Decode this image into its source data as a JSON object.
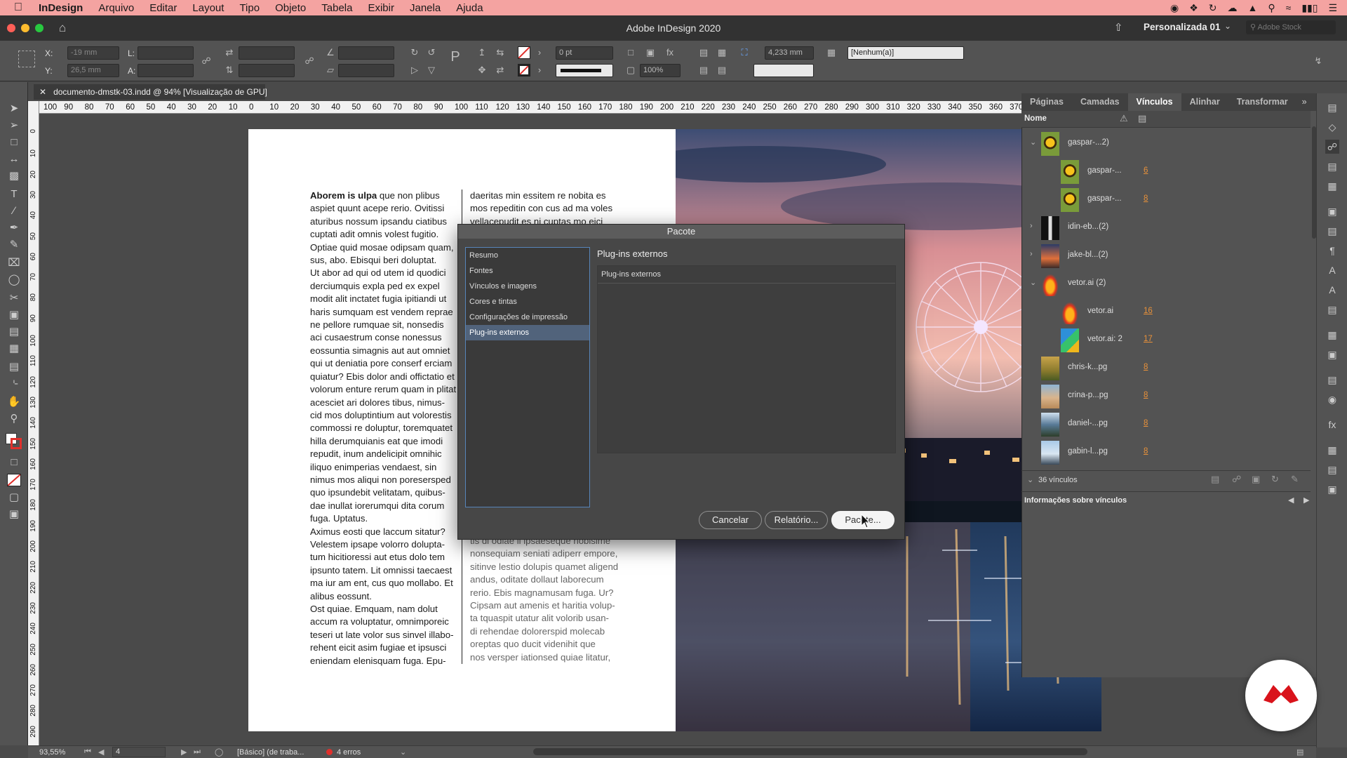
{
  "menubar": {
    "app_name": "InDesign",
    "items": [
      "Arquivo",
      "Editar",
      "Layout",
      "Tipo",
      "Objeto",
      "Tabela",
      "Exibir",
      "Janela",
      "Ajuda"
    ]
  },
  "appbar": {
    "title": "Adobe InDesign 2020",
    "workspace": "Personalizada 01",
    "stock_placeholder": "Adobe Stock"
  },
  "control": {
    "x_label": "X:",
    "x_value": "-19 mm",
    "y_label": "Y:",
    "y_value": "26,5 mm",
    "l_label": "L:",
    "a_label": "A:",
    "stroke_weight": "0 pt",
    "offset_value": "4,233 mm",
    "scale_value": "100%",
    "style_value": "[Nenhum(a)]"
  },
  "document_tab": "documento-dmstk-03.indd @ 94% [Visualização de GPU]",
  "ruler": {
    "h_ticks": [
      "100",
      "90",
      "80",
      "70",
      "60",
      "50",
      "40",
      "30",
      "20",
      "10",
      "0",
      "10",
      "20",
      "30",
      "40",
      "50",
      "60",
      "70",
      "80",
      "90",
      "100",
      "110",
      "120",
      "130",
      "140",
      "150",
      "160",
      "170",
      "180",
      "190",
      "200",
      "210",
      "220",
      "230",
      "240",
      "250",
      "260",
      "270",
      "280",
      "290",
      "300",
      "310",
      "320",
      "330",
      "340",
      "350",
      "360",
      "370"
    ],
    "v_ticks": [
      "0",
      "10",
      "20",
      "30",
      "40",
      "50",
      "60",
      "70",
      "80",
      "90",
      "100",
      "110",
      "120",
      "130",
      "140",
      "150",
      "160",
      "170",
      "180",
      "190",
      "200",
      "210",
      "220",
      "230",
      "240",
      "250",
      "260",
      "270",
      "280",
      "290"
    ]
  },
  "page_text": {
    "bold_lead": "Aborem is ulpa",
    "col1": [
      " que non plibus",
      "aspiet quunt acepe rerio. Ovitissi",
      "aturibus nossum ipsandu ciatibus",
      "cuptati adit omnis volest fugitio.",
      "Optiae quid mosae odipsam quam,",
      "sus, abo. Ebisqui beri doluptat.",
      "Ut abor ad qui od utem id quodici",
      "derciumquis expla ped ex expel",
      "modit alit inctatet fugia ipitiandi ut",
      "haris sumquam est vendem reprae",
      "ne pellore rumquae sit, nonsedis",
      "aci cusaestrum conse nonessus",
      "eossuntia simagnis aut aut omniet",
      "qui ut deniatia pore conserf erciam",
      "quiatur? Ebis dolor andi offictatio et",
      "volorum enture rerum quam in plitat",
      "acesciet ari dolores tibus, nimus-",
      "cid mos doluptintium aut volorestis",
      "commossi re doluptur, toremquatet",
      "hilla derumquianis eat que imodi",
      "repudit, inum andelicipit omnihic",
      "iliquo enimperias vendaest, sin",
      "nimus mos aliqui non poresersped",
      "quo ipsundebit velitatam, quibus-",
      "dae inullat iorerumqui dita corum",
      "fuga. Uptatus.",
      "Aximus eosti que laccum sitatur?",
      "Velestem ipsape volorro dolupta-",
      "tum hicitioressi aut etus dolo tem",
      "ipsunto tatem. Lit omnissi taecaest",
      "ma iur am ent, cus quo mollabo. Et",
      "alibus eossunt.",
      "Ost quiae. Emquam, nam dolut",
      "accum ra voluptatur, omnimporeic",
      "teseri ut late volor sus sinvel illabo-",
      "rehent eicit asim fugiae et ipsusci",
      "eniendam elenisquam fuga. Epu-"
    ],
    "col2_top": [
      "daeritas min essitem re nobita es",
      "mos repeditin con cus ad ma voles",
      "vellacepudit es ni cuptas mo eici"
    ],
    "col2_bottom": [
      "tis di odiae il ipsaeseque nobisime",
      "nonsequiam seniati adiperr empore,",
      "sitinve lestio dolupis quamet aligend",
      "andus, oditate dollaut laborecum",
      "rerio. Ebis magnamusam fuga. Ur?",
      "Cipsam aut amenis et haritia volup-",
      "ta tquaspit utatur alit volorib usan-",
      "di rehendae dolorerspid molecab",
      "oreptas quo ducit videnihit que",
      "nos versper iationsed quiae litatur,"
    ]
  },
  "dialog": {
    "title": "Pacote",
    "nav": [
      "Resumo",
      "Fontes",
      "Vínculos e imagens",
      "Cores e tintas",
      "Configurações de impressão",
      "Plug-ins externos"
    ],
    "section_title": "Plug-ins externos",
    "box_label": "Plug-ins externos",
    "cancel": "Cancelar",
    "report": "Relatório...",
    "package": "Pacote..."
  },
  "panel": {
    "tabs": [
      "Páginas",
      "Camadas",
      "Vínculos",
      "Alinhar",
      "Transformar"
    ],
    "column_name": "Nome",
    "rows": [
      {
        "name": "gaspar-...2)",
        "page": "",
        "level": 0,
        "twisty": "⌄",
        "thumb": "sunflower"
      },
      {
        "name": "gaspar-...",
        "page": "6",
        "level": 1,
        "twisty": "",
        "thumb": "sunflower"
      },
      {
        "name": "gaspar-...",
        "page": "8",
        "level": 1,
        "twisty": "",
        "thumb": "sunflower"
      },
      {
        "name": "idin-eb...(2)",
        "page": "",
        "level": 0,
        "twisty": "›",
        "thumb": "dark"
      },
      {
        "name": "jake-bl...(2)",
        "page": "",
        "level": 0,
        "twisty": "›",
        "thumb": "sunset"
      },
      {
        "name": "vetor.ai (2)",
        "page": "",
        "level": 0,
        "twisty": "⌄",
        "thumb": "flame"
      },
      {
        "name": "vetor.ai",
        "page": "16",
        "level": 1,
        "twisty": "",
        "thumb": "flame"
      },
      {
        "name": "vetor.ai: 2",
        "page": "17",
        "level": 1,
        "twisty": "",
        "thumb": "shapes"
      },
      {
        "name": "chris-k...pg",
        "page": "8",
        "level": 0,
        "twisty": "",
        "thumb": "field"
      },
      {
        "name": "crina-p...pg",
        "page": "8",
        "level": 0,
        "twisty": "",
        "thumb": "sand"
      },
      {
        "name": "daniel-...pg",
        "page": "8",
        "level": 0,
        "twisty": "",
        "thumb": "lake"
      },
      {
        "name": "gabin-l...pg",
        "page": "8",
        "level": 0,
        "twisty": "",
        "thumb": "sky"
      }
    ],
    "count": "36 vínculos",
    "info": "Informações sobre vínculos"
  },
  "status": {
    "zoom": "93,55%",
    "page": "4",
    "profile": "[Básico] (de traba...",
    "errors": "4 erros"
  },
  "colors": {
    "menubar": "#f4a3a1",
    "accent": "#e8913a",
    "error": "#e0302c",
    "logo": "#d9131b"
  }
}
